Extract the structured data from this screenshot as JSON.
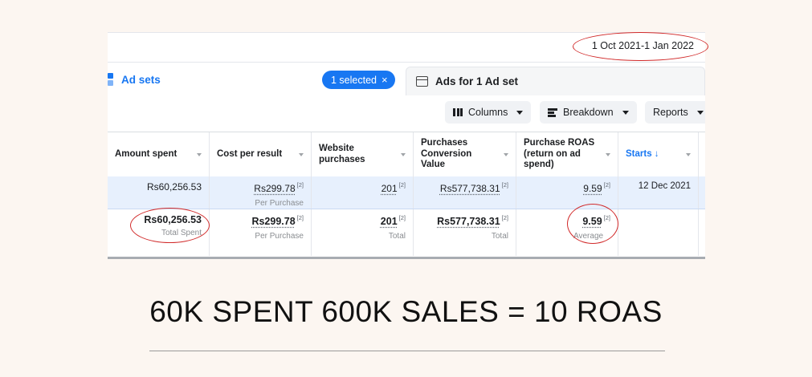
{
  "date_range": "1 Oct 2021-1 Jan 2022",
  "tabs": {
    "ad_sets": "Ad sets",
    "selected_pill": "1 selected",
    "selected_clear": "×",
    "ads_for": "Ads for 1 Ad set"
  },
  "toolbar": {
    "columns": "Columns",
    "breakdown": "Breakdown",
    "reports": "Reports"
  },
  "columns": [
    "Amount spent",
    "Cost per result",
    "Website purchases",
    "Purchases Conversion Value",
    "Purchase ROAS (return on ad spend)",
    "Starts ↓"
  ],
  "row_adset": {
    "amount_spent": "Rs60,256.53",
    "cost_per_result": "Rs299.78",
    "cost_per_result_note": "[2]",
    "cost_per_result_sub": "Per Purchase",
    "website_purchases": "201",
    "website_purchases_note": "[2]",
    "conversion_value": "Rs577,738.31",
    "conversion_value_note": "[2]",
    "roas": "9.59",
    "roas_note": "[2]",
    "starts": "12 Dec 2021"
  },
  "row_total": {
    "amount_spent": "Rs60,256.53",
    "amount_spent_sub": "Total Spent",
    "cost_per_result": "Rs299.78",
    "cost_per_result_note": "[2]",
    "cost_per_result_sub": "Per Purchase",
    "website_purchases": "201",
    "website_purchases_note": "[2]",
    "website_purchases_sub": "Total",
    "conversion_value": "Rs577,738.31",
    "conversion_value_note": "[2]",
    "conversion_value_sub": "Total",
    "roas": "9.59",
    "roas_note": "[2]",
    "roas_sub": "Average"
  },
  "headline": "60K SPENT 600K SALES = 10 ROAS",
  "colors": {
    "accent": "#1877f2",
    "highlight_circle": "#d12a2a",
    "selected_row": "#e7f0fd",
    "page_background": "#fcf6f1"
  }
}
